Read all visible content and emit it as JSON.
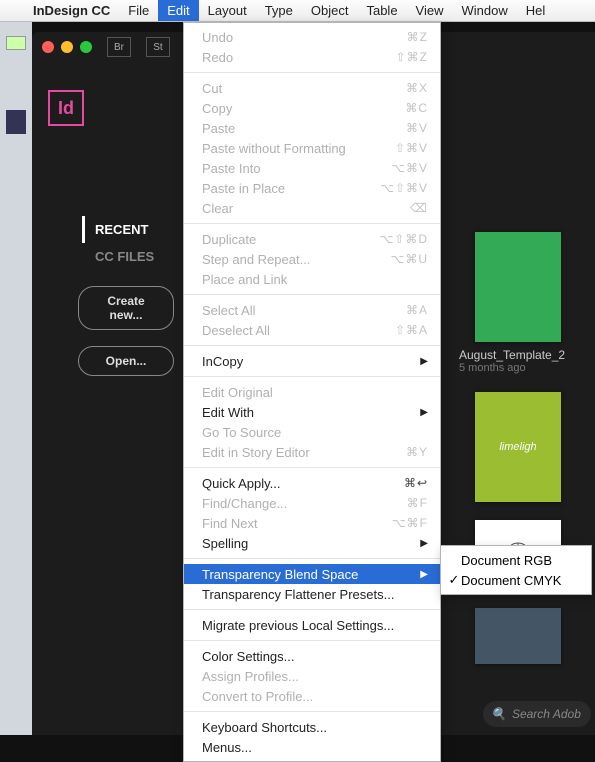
{
  "menubar": {
    "app": "InDesign CC",
    "items": [
      "File",
      "Edit",
      "Layout",
      "Type",
      "Object",
      "Table",
      "View",
      "Window",
      "Hel"
    ],
    "active_index": 1
  },
  "titlebar": {
    "br": "Br",
    "st": "St"
  },
  "logo": "Id",
  "nav": {
    "recent": "RECENT",
    "ccfiles": "CC FILES"
  },
  "buttons": {
    "create": "Create new...",
    "open": "Open..."
  },
  "thumbs": {
    "t1": {
      "name": "August_Template_2",
      "time": "5 months ago"
    },
    "t2": {
      "text": "limeligh"
    }
  },
  "search": {
    "placeholder": "Search Adob"
  },
  "menu": {
    "undo": {
      "l": "Undo",
      "s": "⌘Z"
    },
    "redo": {
      "l": "Redo",
      "s": "⇧⌘Z"
    },
    "cut": {
      "l": "Cut",
      "s": "⌘X"
    },
    "copy": {
      "l": "Copy",
      "s": "⌘C"
    },
    "paste": {
      "l": "Paste",
      "s": "⌘V"
    },
    "pwof": {
      "l": "Paste without Formatting",
      "s": "⇧⌘V"
    },
    "pinto": {
      "l": "Paste Into",
      "s": "⌥⌘V"
    },
    "pplace": {
      "l": "Paste in Place",
      "s": "⌥⇧⌘V"
    },
    "clear": {
      "l": "Clear",
      "s": "⌫"
    },
    "dup": {
      "l": "Duplicate",
      "s": "⌥⇧⌘D"
    },
    "step": {
      "l": "Step and Repeat...",
      "s": "⌥⌘U"
    },
    "plink": {
      "l": "Place and Link",
      "s": ""
    },
    "selall": {
      "l": "Select All",
      "s": "⌘A"
    },
    "desel": {
      "l": "Deselect All",
      "s": "⇧⌘A"
    },
    "incopy": {
      "l": "InCopy",
      "s": "▶"
    },
    "eorig": {
      "l": "Edit Original",
      "s": ""
    },
    "ewith": {
      "l": "Edit With",
      "s": "▶"
    },
    "gosrc": {
      "l": "Go To Source",
      "s": ""
    },
    "estory": {
      "l": "Edit in Story Editor",
      "s": "⌘Y"
    },
    "qapply": {
      "l": "Quick Apply...",
      "s": "⌘↩"
    },
    "find": {
      "l": "Find/Change...",
      "s": "⌘F"
    },
    "fnext": {
      "l": "Find Next",
      "s": "⌥⌘F"
    },
    "spell": {
      "l": "Spelling",
      "s": "▶"
    },
    "tbs": {
      "l": "Transparency Blend Space",
      "s": "▶"
    },
    "tfp": {
      "l": "Transparency Flattener Presets...",
      "s": ""
    },
    "migrate": {
      "l": "Migrate previous Local Settings...",
      "s": ""
    },
    "cset": {
      "l": "Color Settings...",
      "s": ""
    },
    "aprof": {
      "l": "Assign Profiles...",
      "s": ""
    },
    "cprof": {
      "l": "Convert to Profile...",
      "s": ""
    },
    "kbd": {
      "l": "Keyboard Shortcuts...",
      "s": ""
    },
    "menus": {
      "l": "Menus...",
      "s": ""
    }
  },
  "submenu": {
    "rgb": "Document RGB",
    "cmyk": "Document CMYK",
    "check": "✓"
  }
}
